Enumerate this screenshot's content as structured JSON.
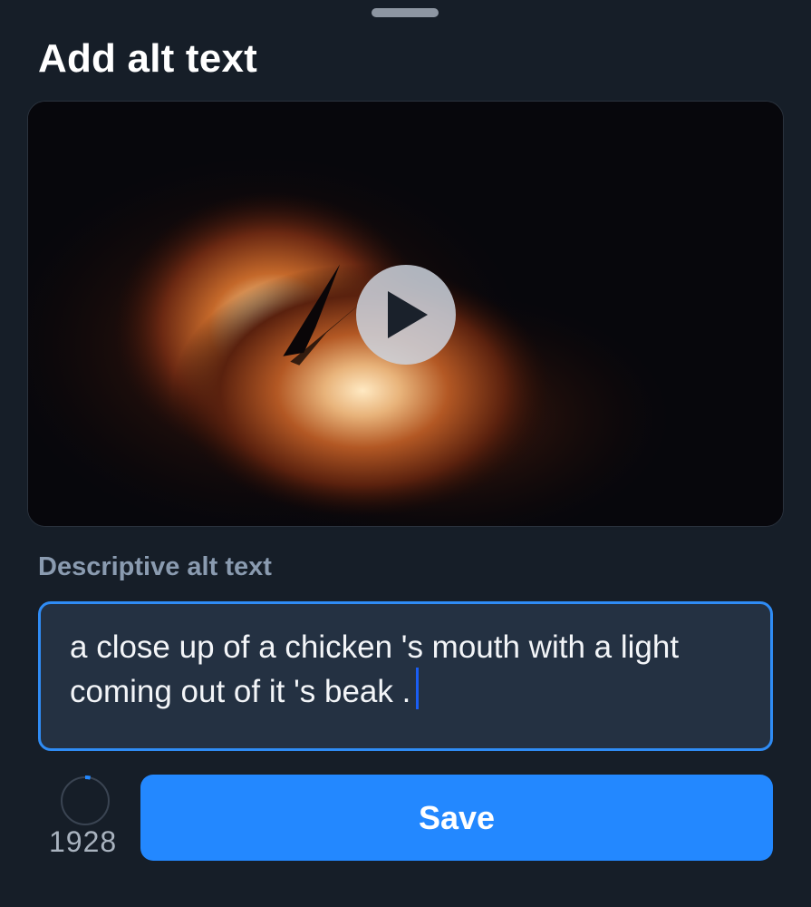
{
  "sheet": {
    "title": "Add alt text"
  },
  "preview": {
    "play_icon": "play-icon"
  },
  "alt_text": {
    "label": "Descriptive alt text",
    "value": "a close up of a chicken 's mouth with a light coming out of it 's beak ."
  },
  "counter": {
    "remaining": "1928",
    "progress_fraction": 0.035
  },
  "actions": {
    "save_label": "Save"
  },
  "colors": {
    "accent": "#2388ff",
    "focus_border": "#2f8cf5",
    "background": "#161e28"
  }
}
